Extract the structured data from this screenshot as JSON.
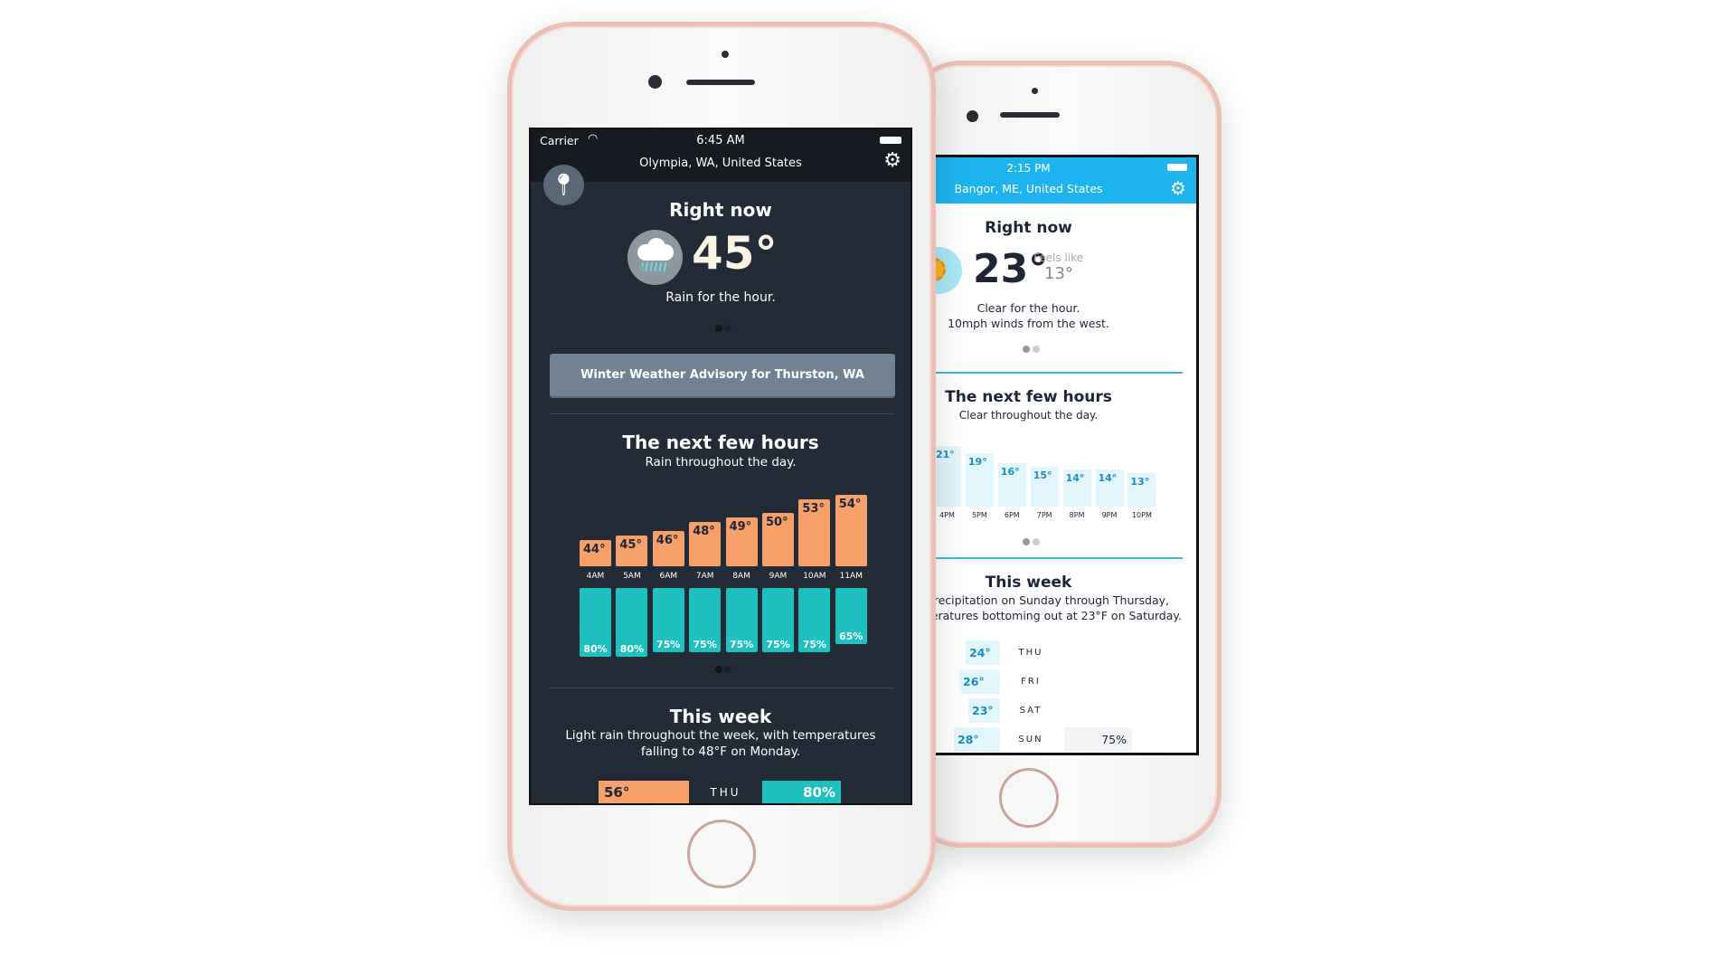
{
  "front": {
    "status": {
      "carrier": "Carrier",
      "time": "6:45 AM"
    },
    "location": "Olympia, WA, United States",
    "now": {
      "title": "Right now",
      "temp": "45°",
      "summary": "Rain for the hour.",
      "icon": "rain-cloud-icon"
    },
    "advisory": "Winter Weather Advisory for Thurston, WA",
    "hours": {
      "title": "The next few hours",
      "subtitle": "Rain throughout the day.",
      "items": [
        {
          "time": "4AM",
          "temp": 44,
          "temp_label": "44°",
          "precip": 80,
          "precip_label": "80%"
        },
        {
          "time": "5AM",
          "temp": 45,
          "temp_label": "45°",
          "precip": 80,
          "precip_label": "80%"
        },
        {
          "time": "6AM",
          "temp": 46,
          "temp_label": "46°",
          "precip": 75,
          "precip_label": "75%"
        },
        {
          "time": "7AM",
          "temp": 48,
          "temp_label": "48°",
          "precip": 75,
          "precip_label": "75%"
        },
        {
          "time": "8AM",
          "temp": 49,
          "temp_label": "49°",
          "precip": 75,
          "precip_label": "75%"
        },
        {
          "time": "9AM",
          "temp": 50,
          "temp_label": "50°",
          "precip": 75,
          "precip_label": "75%"
        },
        {
          "time": "10AM",
          "temp": 53,
          "temp_label": "53°",
          "precip": 75,
          "precip_label": "75%"
        },
        {
          "time": "11AM",
          "temp": 54,
          "temp_label": "54°",
          "precip": 65,
          "precip_label": "65%"
        }
      ]
    },
    "week": {
      "title": "This week",
      "line1": "Light rain throughout the week, with temperatures",
      "line2": "falling to 48°F on Monday.",
      "rows": [
        {
          "day": "THU",
          "temp": "56°",
          "precip": "80%"
        }
      ]
    },
    "colors": {
      "bg": "#232b36",
      "header": "#161b22",
      "temp_bar": "#f7a06a",
      "precip_bar": "#1fc0c0",
      "advisory": "#738292"
    }
  },
  "back": {
    "status": {
      "time": "2:15 PM"
    },
    "location": "Bangor, ME, United States",
    "now": {
      "title": "Right now",
      "temp": "23°",
      "feels_label": "Feels like",
      "feels_temp": "13°",
      "line1": "Clear for the hour.",
      "line2": "10mph winds from the west.",
      "icon": "sun-icon"
    },
    "hours": {
      "title": "The next few hours",
      "subtitle": "Clear throughout the day.",
      "items": [
        {
          "time": "4PM",
          "temp": 21,
          "temp_label": "21°"
        },
        {
          "time": "5PM",
          "temp": 19,
          "temp_label": "19°"
        },
        {
          "time": "6PM",
          "temp": 16,
          "temp_label": "16°"
        },
        {
          "time": "7PM",
          "temp": 15,
          "temp_label": "15°"
        },
        {
          "time": "8PM",
          "temp": 14,
          "temp_label": "14°"
        },
        {
          "time": "9PM",
          "temp": 14,
          "temp_label": "14°"
        },
        {
          "time": "10PM",
          "temp": 13,
          "temp_label": "13°"
        }
      ]
    },
    "week": {
      "title": "This week",
      "line1": "recipitation on Sunday through Thursday,",
      "line2": "eratures bottoming out at 23°F on Saturday.",
      "rows": [
        {
          "day": "THU",
          "temp": "24°",
          "precip": ""
        },
        {
          "day": "FRI",
          "temp": "26°",
          "precip": ""
        },
        {
          "day": "SAT",
          "temp": "23°",
          "precip": ""
        },
        {
          "day": "SUN",
          "temp": "28°",
          "precip": "75%"
        }
      ]
    },
    "colors": {
      "header": "#1eb4f0",
      "bar": "#e3f6fc",
      "accent": "#1a8dc4",
      "text": "#1e2538"
    }
  }
}
